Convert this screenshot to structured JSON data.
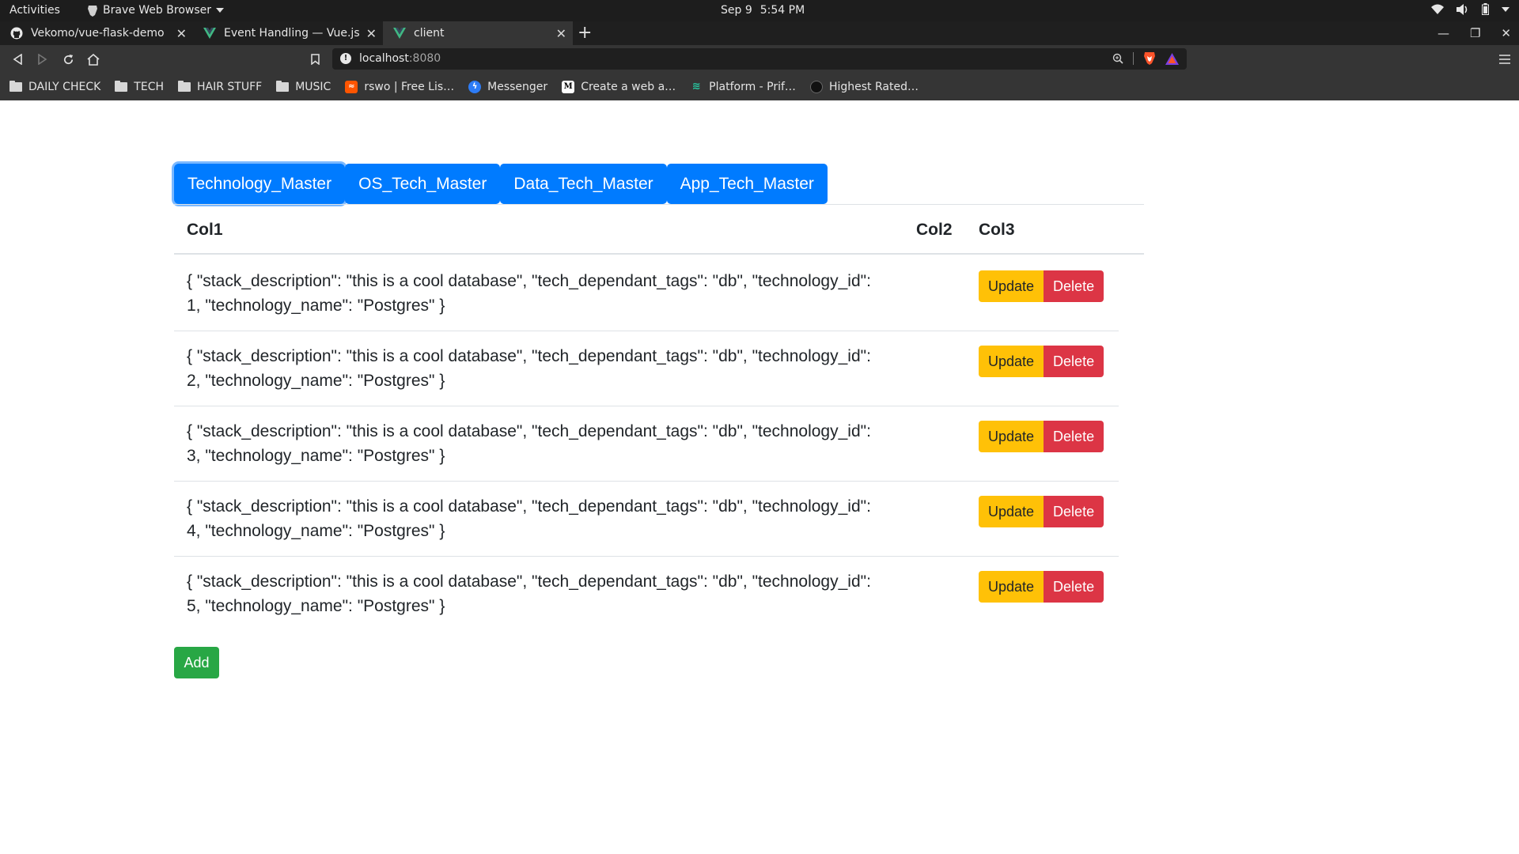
{
  "system_bar": {
    "activities": "Activities",
    "app_name": "Brave Web Browser",
    "date": "Sep 9",
    "time": "5:54 PM"
  },
  "browser": {
    "tabs": [
      {
        "title": "Vekomo/vue-flask-demo",
        "icon": "github-icon"
      },
      {
        "title": "Event Handling — Vue.js",
        "icon": "vue-icon"
      },
      {
        "title": "client",
        "icon": "vue-icon"
      }
    ],
    "url_host": "localhost",
    "url_port": ":8080",
    "bookmarks": [
      {
        "label": "DAILY CHECK",
        "icon": "folder-icon"
      },
      {
        "label": "TECH",
        "icon": "folder-icon"
      },
      {
        "label": "HAIR STUFF",
        "icon": "folder-icon"
      },
      {
        "label": "MUSIC",
        "icon": "folder-icon"
      },
      {
        "label": "rswo | Free Lis…",
        "icon": "soundcloud-icon"
      },
      {
        "label": "Messenger",
        "icon": "messenger-icon"
      },
      {
        "label": "Create a web a…",
        "icon": "medium-icon"
      },
      {
        "label": "Platform - Prif…",
        "icon": "layers-icon"
      },
      {
        "label": "Highest Rated…",
        "icon": "circle-icon"
      }
    ]
  },
  "app": {
    "tabs": [
      "Technology_Master",
      "OS_Tech_Master",
      "Data_Tech_Master",
      "App_Tech_Master"
    ],
    "columns": {
      "col1": "Col1",
      "col2": "Col2",
      "col3": "Col3"
    },
    "rows": [
      {
        "line1": "{ \"stack_description\": \"this is a cool database\", \"tech_dependant_tags\": \"db\", \"technology_id\":",
        "line2": "1, \"technology_name\": \"Postgres\" }"
      },
      {
        "line1": "{ \"stack_description\": \"this is a cool database\", \"tech_dependant_tags\": \"db\", \"technology_id\":",
        "line2": "2, \"technology_name\": \"Postgres\" }"
      },
      {
        "line1": "{ \"stack_description\": \"this is a cool database\", \"tech_dependant_tags\": \"db\", \"technology_id\":",
        "line2": "3, \"technology_name\": \"Postgres\" }"
      },
      {
        "line1": "{ \"stack_description\": \"this is a cool database\", \"tech_dependant_tags\": \"db\", \"technology_id\":",
        "line2": "4, \"technology_name\": \"Postgres\" }"
      },
      {
        "line1": "{ \"stack_description\": \"this is a cool database\", \"tech_dependant_tags\": \"db\", \"technology_id\":",
        "line2": "5, \"technology_name\": \"Postgres\" }"
      }
    ],
    "update_label": "Update",
    "delete_label": "Delete",
    "add_label": "Add",
    "colors": {
      "primary": "#007bff",
      "warning": "#ffc107",
      "danger": "#dc3545",
      "success": "#28a745"
    }
  }
}
